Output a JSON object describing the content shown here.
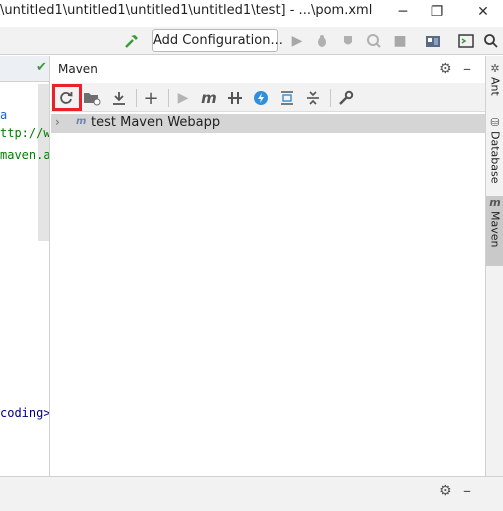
{
  "window": {
    "title": "\\untitled1\\untitled1\\untitled1\\untitled1\\test] - ...\\pom.xml",
    "minimize": "─",
    "restore": "❐",
    "close": "✕"
  },
  "toolbar": {
    "add_configuration": "Add Configuration..."
  },
  "editor": {
    "lines": [
      {
        "text": "a",
        "color": "#1a5fd6"
      },
      {
        "text": "ttp://ww",
        "color": "#007f00"
      },
      {
        "text": "maven.ap",
        "color": "#007f00"
      },
      {
        "text": "coding>",
        "color": "#00007f"
      }
    ]
  },
  "maven": {
    "title": "Maven",
    "tree": {
      "project": "test Maven Webapp",
      "icon_letter": "m"
    },
    "toolbar_icons": [
      "reload-icon",
      "add-folder-icon",
      "download-icon",
      "plus-icon",
      "run-icon",
      "maven-goal-icon",
      "toggle-offline-icon",
      "skip-tests-icon",
      "show-dependencies-icon",
      "collapse-all-icon",
      "settings-wrench-icon"
    ]
  },
  "stripe": {
    "ant": "Ant",
    "database": "Database",
    "maven": "Maven"
  },
  "colors": {
    "highlight": "#e8212b",
    "hammer": "#3c9a3c",
    "accent_blue": "#2f8fd8"
  }
}
